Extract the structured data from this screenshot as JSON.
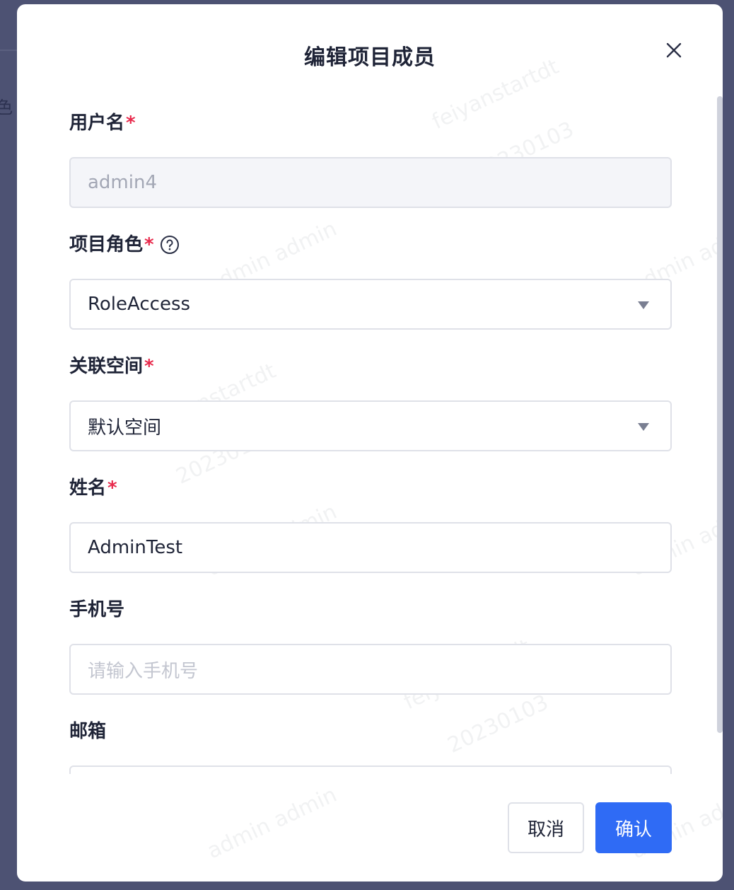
{
  "background": {
    "partial_char": "色"
  },
  "modal": {
    "title": "编辑项目成员",
    "close_icon": "close-icon"
  },
  "form": {
    "username": {
      "label": "用户名",
      "required_mark": "*",
      "value": "admin4",
      "disabled": true
    },
    "role": {
      "label": "项目角色",
      "required_mark": "*",
      "help_icon": "question-circle-icon",
      "value": "RoleAccess"
    },
    "space": {
      "label": "关联空间",
      "required_mark": "*",
      "value": "默认空间"
    },
    "name": {
      "label": "姓名",
      "required_mark": "*",
      "value": "AdminTest"
    },
    "phone": {
      "label": "手机号",
      "placeholder": "请输入手机号",
      "value": ""
    },
    "email": {
      "label": "邮箱",
      "value": ""
    }
  },
  "footer": {
    "cancel_label": "取消",
    "confirm_label": "确认"
  },
  "watermarks": {
    "user": "admin admin",
    "code": "feiyanstartdt",
    "date": "20230103"
  },
  "colors": {
    "primary": "#2f6bf5",
    "required": "#e8294b",
    "overlay": "#4d5273"
  }
}
